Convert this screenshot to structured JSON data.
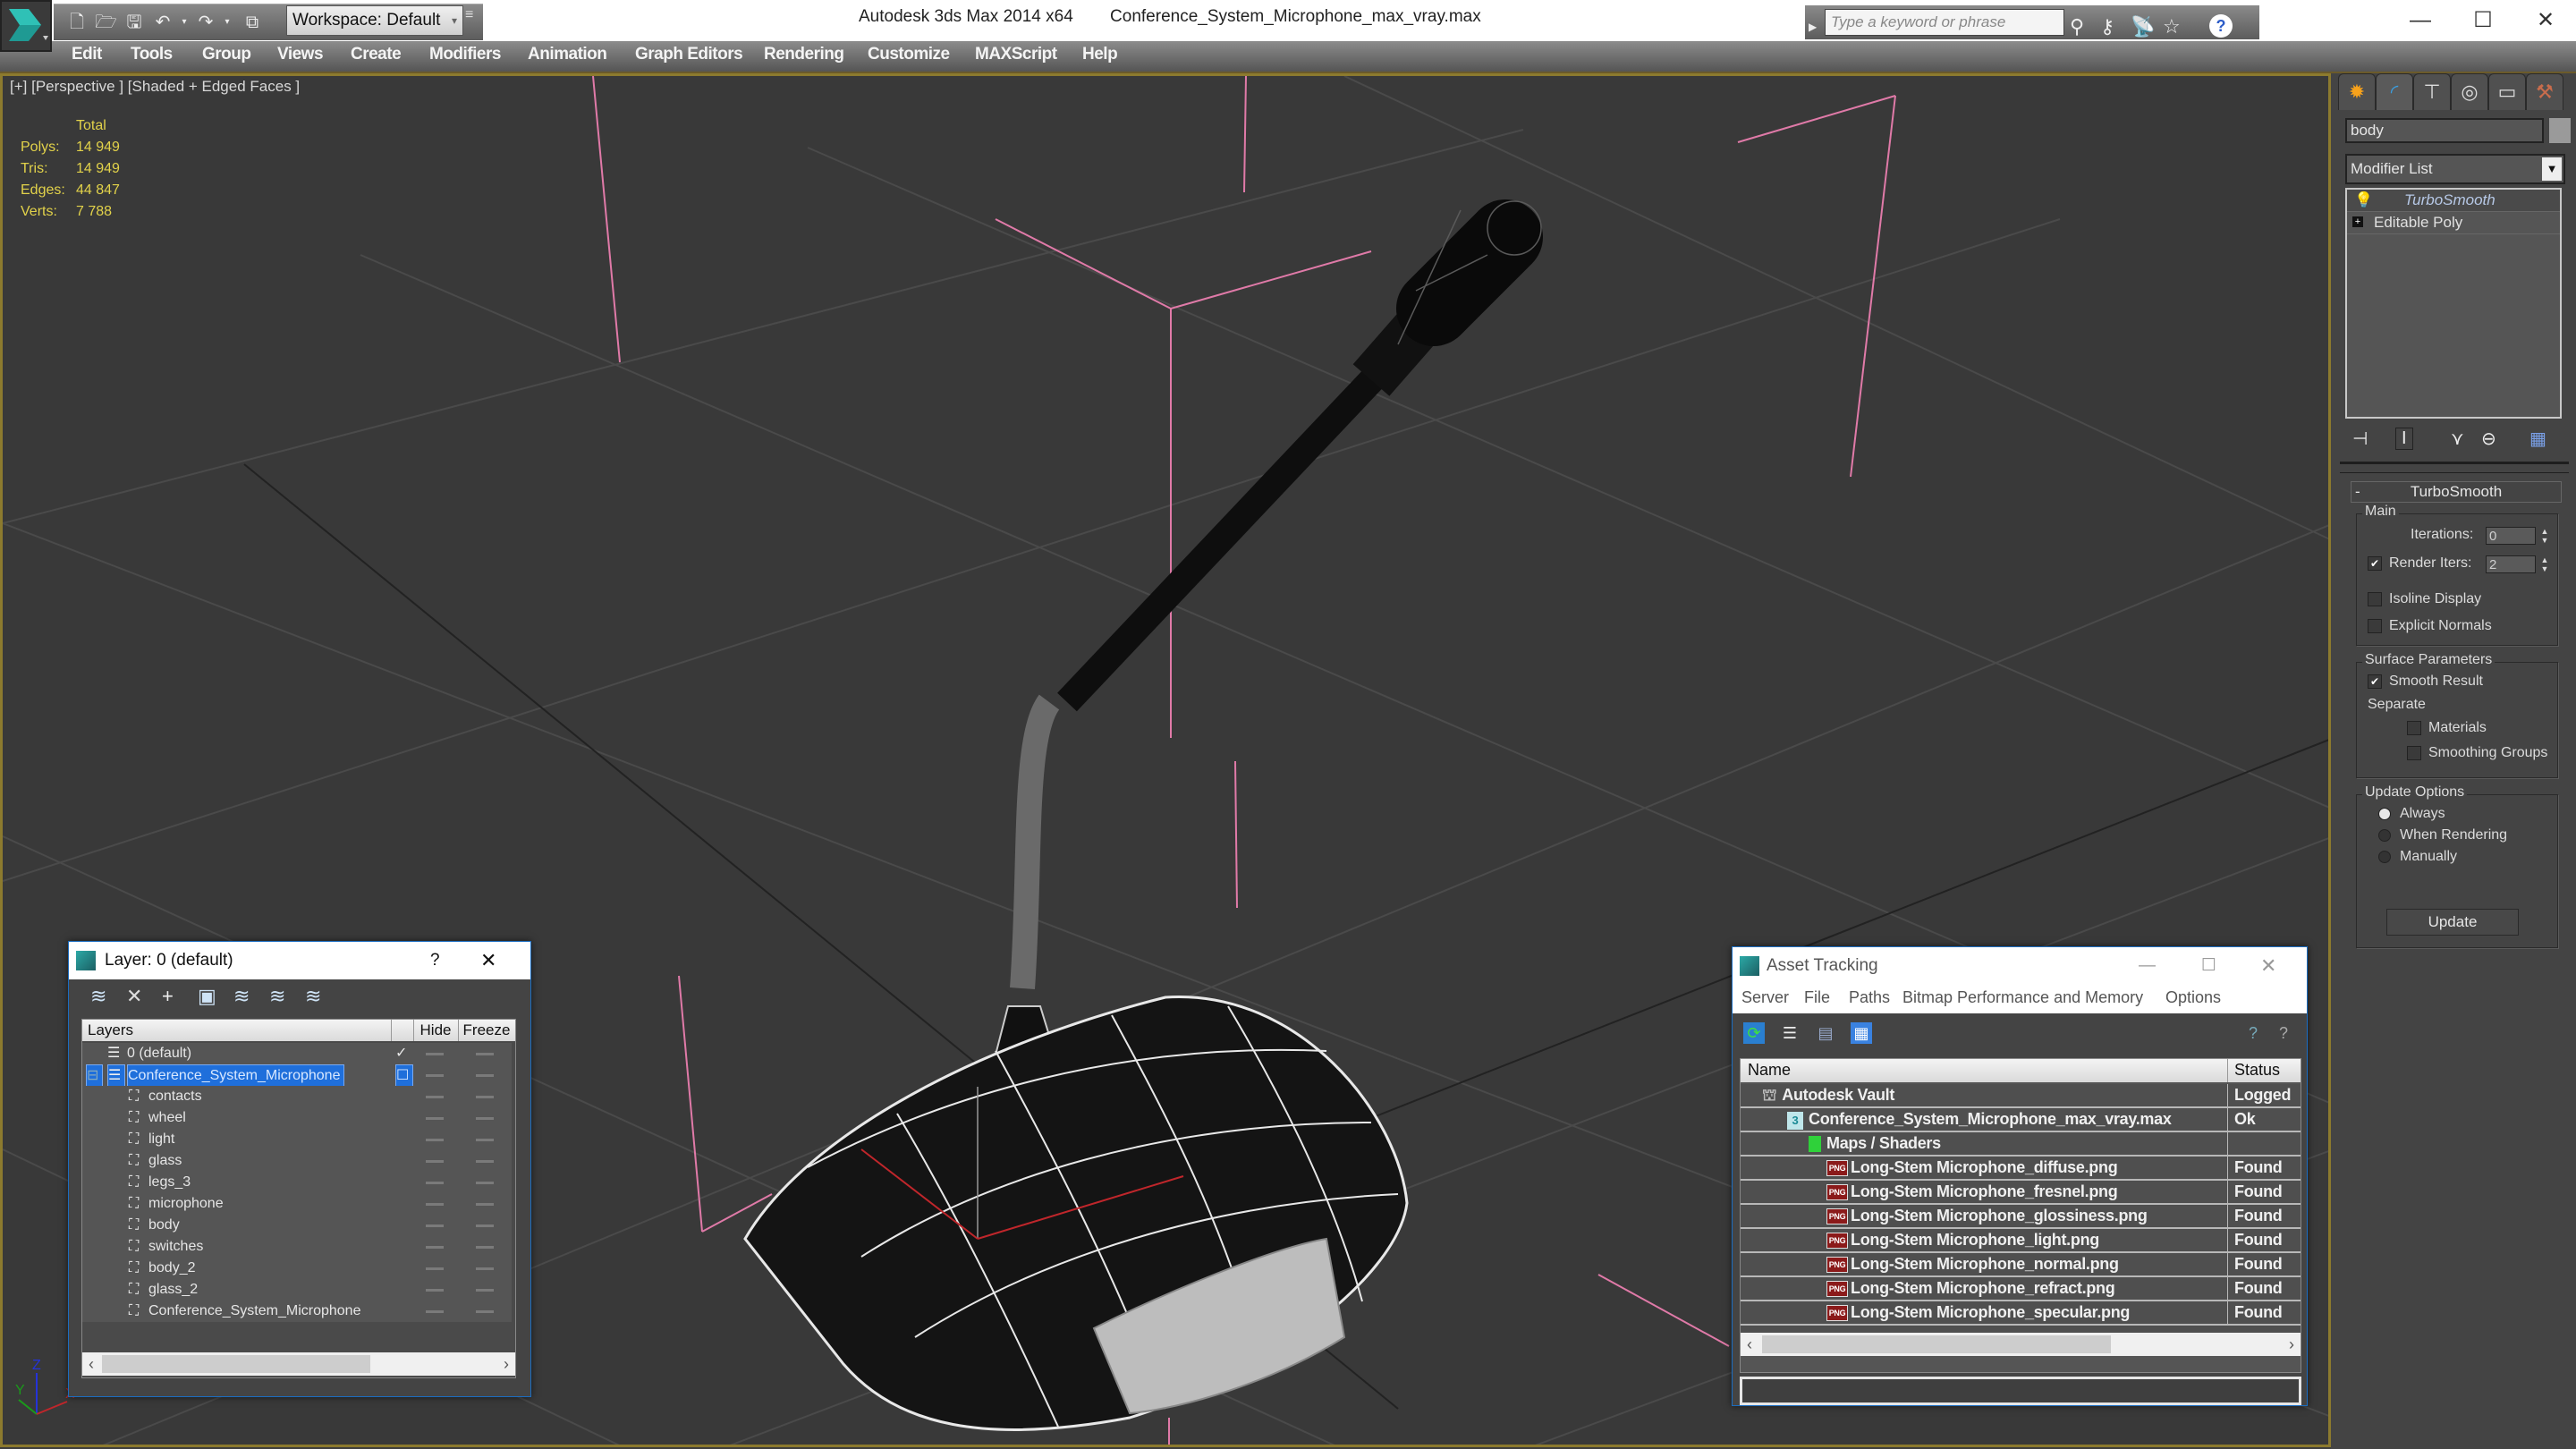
{
  "titlebar": {
    "app_title": "Autodesk 3ds Max  2014 x64",
    "file_name": "Conference_System_Microphone_max_vray.max",
    "workspace_label": "Workspace: Default",
    "search_placeholder": "Type a keyword or phrase",
    "window_controls": {
      "minimize": "—",
      "maximize": "☐",
      "close": "✕"
    }
  },
  "menubar": {
    "items": [
      "Edit",
      "Tools",
      "Group",
      "Views",
      "Create",
      "Modifiers",
      "Animation",
      "Graph Editors",
      "Rendering",
      "Customize",
      "MAXScript",
      "Help"
    ]
  },
  "viewport": {
    "label": "[+] [Perspective ] [Shaded + Edged Faces ]",
    "stats": {
      "header": "Total",
      "rows": [
        {
          "label": "Polys:",
          "value": "14 949"
        },
        {
          "label": "Tris:",
          "value": "14 949"
        },
        {
          "label": "Edges:",
          "value": "44 847"
        },
        {
          "label": "Verts:",
          "value": "7 788"
        }
      ]
    },
    "axis_labels": {
      "x": "X",
      "y": "Y",
      "z": "Z"
    }
  },
  "command_panel": {
    "tabs": [
      "create",
      "modify",
      "hierarchy",
      "motion",
      "display",
      "utilities"
    ],
    "object_name": "body",
    "modifier_list_label": "Modifier List",
    "stack": [
      {
        "label": "TurboSmooth",
        "selected": true
      },
      {
        "label": "Editable Poly",
        "selected": false
      }
    ],
    "rollout": {
      "title": "TurboSmooth",
      "collapse_symbol": "-",
      "main": {
        "title": "Main",
        "iterations_label": "Iterations:",
        "iterations_value": "0",
        "render_iters_label": "Render Iters:",
        "render_iters_value": "2",
        "render_iters_checked": true,
        "isoline_label": "Isoline Display",
        "isoline_checked": false,
        "explicit_normals_label": "Explicit Normals",
        "explicit_normals_checked": false
      },
      "surface": {
        "title": "Surface Parameters",
        "smooth_result_label": "Smooth Result",
        "smooth_result_checked": true,
        "separate_label": "Separate",
        "materials_label": "Materials",
        "smoothing_groups_label": "Smoothing Groups"
      },
      "update": {
        "title": "Update Options",
        "options": [
          "Always",
          "When Rendering",
          "Manually"
        ],
        "selected": "Always",
        "button_label": "Update"
      }
    }
  },
  "layer_dialog": {
    "title": "Layer: 0 (default)",
    "help": "?",
    "close": "✕",
    "columns": [
      "Layers",
      "",
      "Hide",
      "Freeze"
    ],
    "rows": [
      {
        "name": "0 (default)",
        "level": 0,
        "type": "layer",
        "current": true
      },
      {
        "name": "Conference_System_Microphone",
        "level": 0,
        "type": "layer",
        "selected": true,
        "expanded": true
      },
      {
        "name": "contacts",
        "level": 1,
        "type": "object"
      },
      {
        "name": "wheel",
        "level": 1,
        "type": "object"
      },
      {
        "name": "light",
        "level": 1,
        "type": "object"
      },
      {
        "name": "glass",
        "level": 1,
        "type": "object"
      },
      {
        "name": "legs_3",
        "level": 1,
        "type": "object"
      },
      {
        "name": "microphone",
        "level": 1,
        "type": "object"
      },
      {
        "name": "body",
        "level": 1,
        "type": "object"
      },
      {
        "name": "switches",
        "level": 1,
        "type": "object"
      },
      {
        "name": "body_2",
        "level": 1,
        "type": "object"
      },
      {
        "name": "glass_2",
        "level": 1,
        "type": "object"
      },
      {
        "name": "Conference_System_Microphone",
        "level": 1,
        "type": "object"
      }
    ]
  },
  "asset_dialog": {
    "title": "Asset Tracking",
    "menu": [
      "Server",
      "File",
      "Paths",
      "Bitmap Performance and Memory",
      "Options"
    ],
    "columns": [
      "Name",
      "Status"
    ],
    "rows": [
      {
        "name": "Autodesk Vault",
        "status": "Logged O",
        "level": 0,
        "icon": "vault"
      },
      {
        "name": "Conference_System_Microphone_max_vray.max",
        "status": "Ok",
        "level": 1,
        "icon": "max-file"
      },
      {
        "name": "Maps / Shaders",
        "status": "",
        "level": 2,
        "icon": "maps"
      },
      {
        "name": "Long-Stem Microphone_diffuse.png",
        "status": "Found",
        "level": 3,
        "icon": "png"
      },
      {
        "name": "Long-Stem Microphone_fresnel.png",
        "status": "Found",
        "level": 3,
        "icon": "png"
      },
      {
        "name": "Long-Stem Microphone_glossiness.png",
        "status": "Found",
        "level": 3,
        "icon": "png"
      },
      {
        "name": "Long-Stem Microphone_light.png",
        "status": "Found",
        "level": 3,
        "icon": "png"
      },
      {
        "name": "Long-Stem Microphone_normal.png",
        "status": "Found",
        "level": 3,
        "icon": "png"
      },
      {
        "name": "Long-Stem Microphone_refract.png",
        "status": "Found",
        "level": 3,
        "icon": "png"
      },
      {
        "name": "Long-Stem Microphone_specular.png",
        "status": "Found",
        "level": 3,
        "icon": "png"
      }
    ],
    "png_badge": "PNG"
  },
  "colors": {
    "viewport_border": "#8c7a2e",
    "stats_text": "#e2d24a",
    "selection_blue": "#1f6fdb",
    "bounding_box_pink": "#e07aa8"
  }
}
